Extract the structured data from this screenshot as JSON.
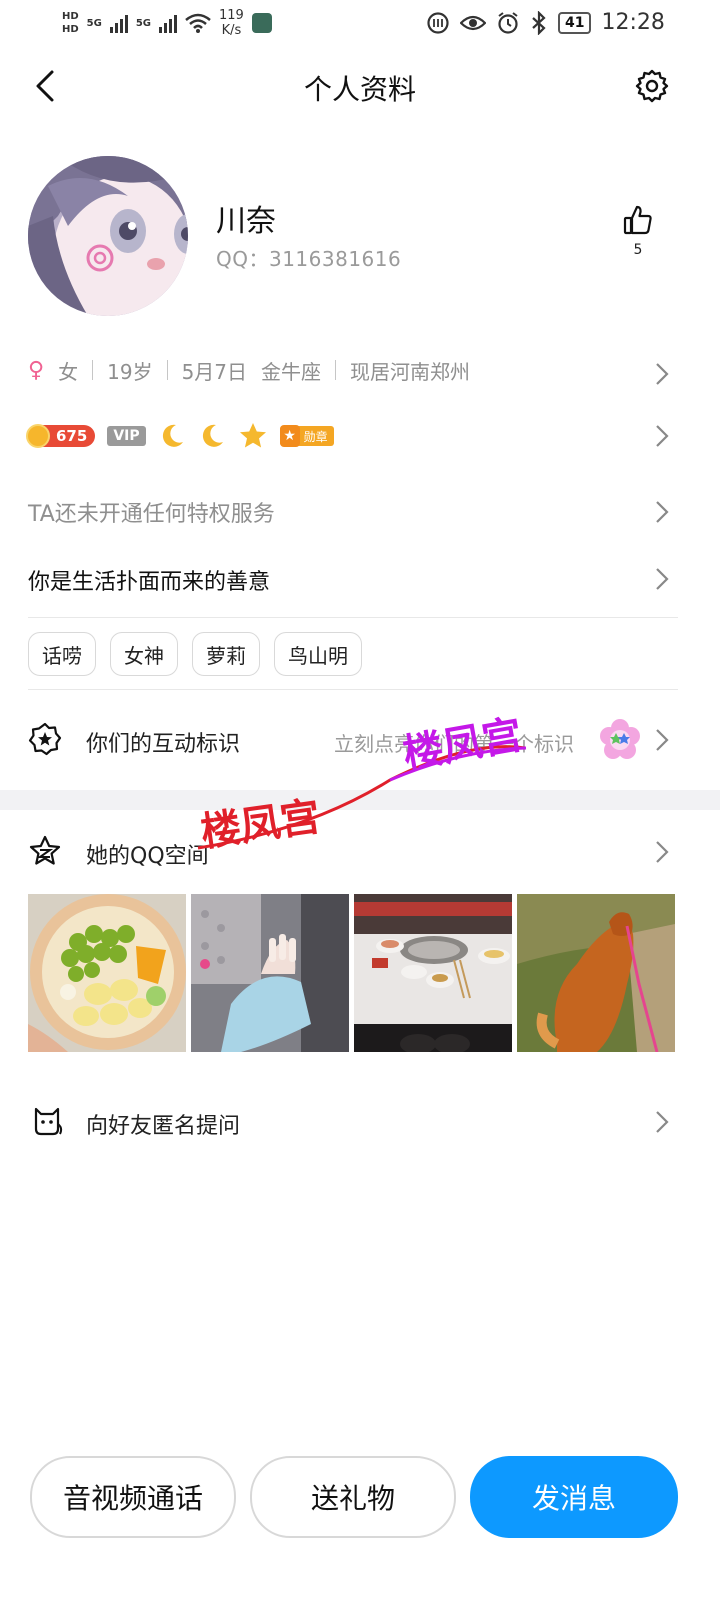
{
  "status_bar": {
    "hd_top": "HD",
    "hd_bottom": "HD",
    "net1": "5G",
    "net2": "5G",
    "speed_value": "119",
    "speed_unit": "K/s",
    "battery": "41",
    "time": "12:28"
  },
  "header": {
    "title": "个人资料"
  },
  "profile": {
    "name": "川奈",
    "qq_label": "QQ：3116381616",
    "likes": "5"
  },
  "info": {
    "gender": "女",
    "age": "19岁",
    "birthday": "5月7日",
    "zodiac": "金牛座",
    "location": "现居河南郑州"
  },
  "badges": {
    "level": "675",
    "vip": "VIP",
    "medal": "勋章"
  },
  "privilege_text": "TA还未开通任何特权服务",
  "signature": "你是生活扑面而来的善意",
  "tags": [
    "话唠",
    "女神",
    "萝莉",
    "鸟山明"
  ],
  "interaction": {
    "label": "你们的互动标识",
    "hint": "立刻点亮你们的第一个标识"
  },
  "qzone": {
    "label": "她的QQ空间"
  },
  "ask": {
    "label": "向好友匿名提问"
  },
  "watermark": {
    "text": "楼凤宫"
  },
  "buttons": {
    "call": "音视频通话",
    "gift": "送礼物",
    "message": "发消息"
  },
  "colors": {
    "primary": "#0d99ff",
    "gender": "#f06292",
    "level_badge": "#e84a36",
    "medal": "#f4a623",
    "watermark_red": "#e0202a",
    "watermark_magenta": "#c418e8"
  }
}
